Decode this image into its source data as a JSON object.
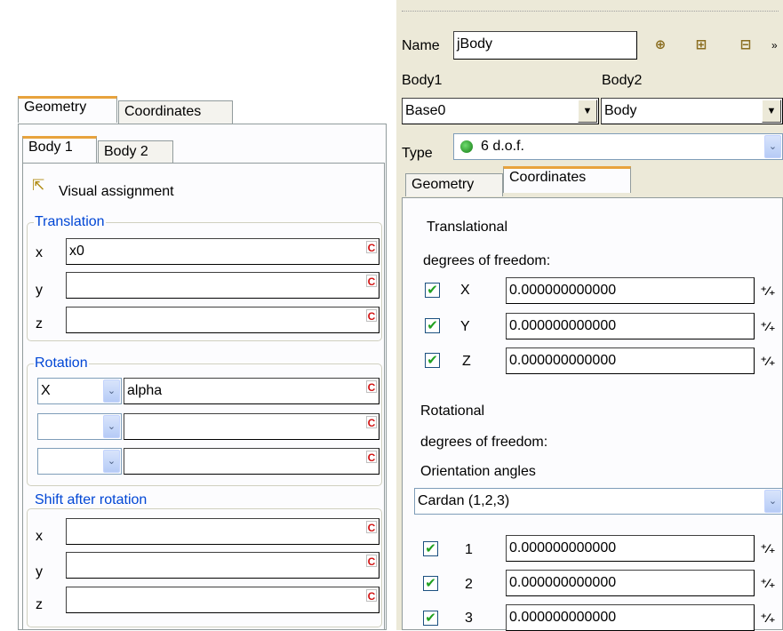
{
  "left": {
    "outer_tabs": [
      "Geometry",
      "Coordinates"
    ],
    "inner_tabs": [
      "Body 1",
      "Body 2"
    ],
    "visual_assignment": "Visual assignment",
    "translation": {
      "title": "Translation",
      "rows": [
        {
          "label": "x",
          "value": "x0"
        },
        {
          "label": "y",
          "value": ""
        },
        {
          "label": "z",
          "value": ""
        }
      ]
    },
    "rotation": {
      "title": "Rotation",
      "rows": [
        {
          "axis": "X",
          "value": "alpha"
        },
        {
          "axis": "",
          "value": ""
        },
        {
          "axis": "",
          "value": ""
        }
      ]
    },
    "shift": {
      "title": "Shift after rotation",
      "rows": [
        {
          "label": "x",
          "value": ""
        },
        {
          "label": "y",
          "value": ""
        },
        {
          "label": "z",
          "value": ""
        }
      ]
    },
    "c_glyph": "C"
  },
  "right": {
    "name_label": "Name",
    "name_value": "jBody",
    "body1_label": "Body1",
    "body1_value": "Base0",
    "body2_label": "Body2",
    "body2_value": "Body",
    "type_label": "Type",
    "type_value": "6 d.o.f.",
    "tabs": [
      "Geometry",
      "Coordinates"
    ],
    "translational_line1": "Translational",
    "translational_line2": "degrees of freedom:",
    "trans_rows": [
      {
        "label": "X",
        "value": "0.000000000000",
        "checked": true
      },
      {
        "label": "Y",
        "value": "0.000000000000",
        "checked": true
      },
      {
        "label": "Z",
        "value": "0.000000000000",
        "checked": true
      }
    ],
    "rotational_line1": "Rotational",
    "rotational_line2": "degrees of freedom:",
    "orientation_label": "Orientation angles",
    "orientation_value": "Cardan (1,2,3)",
    "rot_rows": [
      {
        "label": "1",
        "value": "0.000000000000",
        "checked": true
      },
      {
        "label": "2",
        "value": "0.000000000000",
        "checked": true
      },
      {
        "label": "3",
        "value": "0.000000000000",
        "checked": true
      }
    ]
  },
  "icons": {
    "check_glyph": "✔",
    "combo_arrow": "▼",
    "combo_chevron": "⌄",
    "spin_glyph": "⁺⁄₊"
  },
  "colors": {
    "group_title": "#0046d5",
    "active_tab_accent": "#e8a33d",
    "check_green": "#21a121",
    "c_red": "#d21414"
  }
}
